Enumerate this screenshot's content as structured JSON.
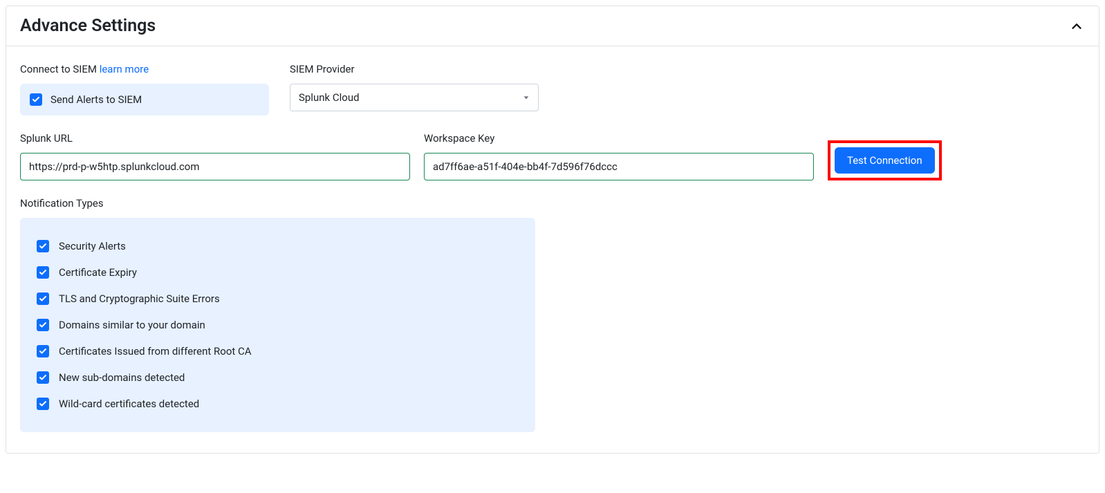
{
  "header": {
    "title": "Advance Settings"
  },
  "siem": {
    "connect_label": "Connect to SIEM ",
    "learn_more": "learn more",
    "send_alerts_label": "Send Alerts to SIEM"
  },
  "provider": {
    "label": "SIEM Provider",
    "selected": "Splunk Cloud"
  },
  "url": {
    "label": "Splunk URL",
    "value": "https://prd-p-w5htp.splunkcloud.com"
  },
  "key": {
    "label": "Workspace Key",
    "value": "ad7ff6ae-a51f-404e-bb4f-7d596f76dccc"
  },
  "test_button": "Test Connection",
  "notifications": {
    "label": "Notification Types",
    "items": [
      "Security Alerts",
      "Certificate Expiry",
      "TLS and Cryptographic Suite Errors",
      "Domains similar to your domain",
      "Certificates Issued from different Root CA",
      "New sub-domains detected",
      "Wild-card certificates detected"
    ]
  }
}
